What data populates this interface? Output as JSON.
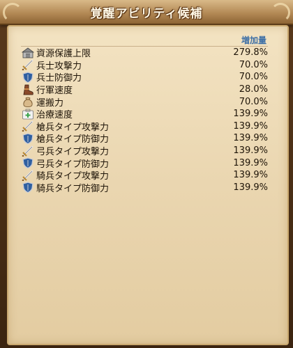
{
  "window": {
    "title": "覚醒アビリティ候補"
  },
  "table": {
    "value_header": "増加量",
    "rows": [
      {
        "label": "資源保護上限",
        "value": "279.8%",
        "icon": "warehouse-icon"
      },
      {
        "label": "兵士攻撃力",
        "value": "70.0%",
        "icon": "sword-icon"
      },
      {
        "label": "兵士防御力",
        "value": "70.0%",
        "icon": "shield-icon"
      },
      {
        "label": "行軍速度",
        "value": "28.0%",
        "icon": "boot-icon"
      },
      {
        "label": "運搬力",
        "value": "70.0%",
        "icon": "sack-icon"
      },
      {
        "label": "治療速度",
        "value": "139.9%",
        "icon": "first-aid-kit-icon"
      },
      {
        "label": "槍兵タイプ攻撃力",
        "value": "139.9%",
        "icon": "sword-icon"
      },
      {
        "label": "槍兵タイプ防御力",
        "value": "139.9%",
        "icon": "shield-icon"
      },
      {
        "label": "弓兵タイプ攻撃力",
        "value": "139.9%",
        "icon": "sword-icon"
      },
      {
        "label": "弓兵タイプ防御力",
        "value": "139.9%",
        "icon": "shield-icon"
      },
      {
        "label": "騎兵タイプ攻撃力",
        "value": "139.9%",
        "icon": "sword-icon"
      },
      {
        "label": "騎兵タイプ防御力",
        "value": "139.9%",
        "icon": "shield-icon"
      }
    ]
  },
  "colors": {
    "header_accent": "#3d6fa6",
    "parchment": "#f0dfbc",
    "frame": "#4a2f15"
  }
}
